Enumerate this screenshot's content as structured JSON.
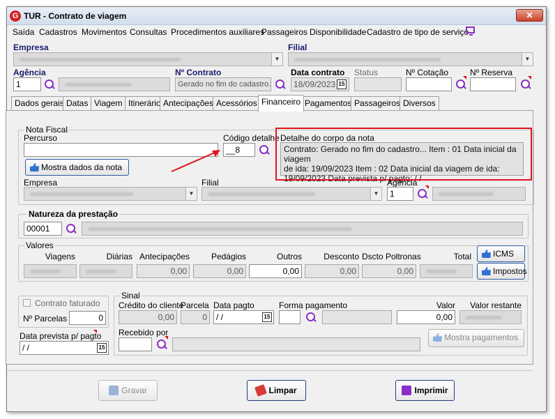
{
  "window": {
    "title": "TUR - Contrato de viagem",
    "close_label": "✕"
  },
  "menu": [
    "Saída",
    "Cadastros",
    "Movimentos",
    "Consultas",
    "Procedimentos auxiliares",
    "Passageiros",
    "Disponibilidade",
    "Cadastro de tipo de serviço"
  ],
  "header": {
    "empresa_label": "Empresa",
    "filial_label": "Filial",
    "agencia_label": "Agência",
    "agencia_value": "1",
    "contrato_label": "Nº Contrato",
    "contrato_value": "Gerado no fim do cadastro...",
    "data_contrato_label": "Data contrato",
    "data_contrato_value": "18/09/2023",
    "status_label": "Status",
    "cotacao_label": "Nº Cotação",
    "reserva_label": "Nº Reserva"
  },
  "tabs": [
    "Dados gerais",
    "Datas",
    "Viagem",
    "Itinerário",
    "Antecipações",
    "Acessórios",
    "Financeiro",
    "Pagamentos",
    "Passageiros",
    "Diversos"
  ],
  "active_tab": "Financeiro",
  "nota_fiscal": {
    "group_title": "Nota Fiscal",
    "percurso_label": "Percurso",
    "percurso_value": "",
    "codigo_detalhe_label": "Código detalhe",
    "codigo_detalhe_value": "__8",
    "mostra_button": "Mostra dados da nota",
    "empresa_label": "Empresa",
    "filial_label": "Filial",
    "agencia_label": "Agência",
    "agencia_value": "1",
    "detalhe_label": "Detalhe do corpo da nota",
    "detalhe_lines": [
      "Contrato: Gerado no fim do cadastro...  Item : 01  Data inicial da viagem",
      "de ida: 19/09/2023    Item : 02  Data inicial da viagem de ida:",
      "19/09/2023  Data prevista p/ pagto:  / /"
    ]
  },
  "natureza": {
    "title": "Natureza da prestação",
    "code": "00001"
  },
  "valores": {
    "title": "Valores",
    "headers": [
      "Viagens",
      "Diárias",
      "Antecipações",
      "Pedágios",
      "Outros",
      "Desconto",
      "Dscto Poltronas",
      "Total"
    ],
    "values": [
      "",
      "",
      "0,00",
      "0,00",
      "0,00",
      "0,00",
      "0,00",
      ""
    ],
    "icms_button": "ICMS",
    "impostos_button": "Impostos"
  },
  "faturado": {
    "contrato_faturado_label": "Contrato faturado",
    "parcelas_label": "Nº Parcelas",
    "parcelas_value": "0",
    "data_prevista_label": "Data prevista p/ pagto",
    "data_prevista_value": " / /"
  },
  "sinal": {
    "title": "Sinal",
    "credito_label": "Crédito do cliente",
    "credito_value": "0,00",
    "parcela_label": "Parcela",
    "parcela_value": "0",
    "data_pagto_label": "Data pagto",
    "data_pagto_value": " / /",
    "forma_label": "Forma pagamento",
    "valor_label": "Valor",
    "valor_value": "0,00",
    "valor_restante_label": "Valor restante",
    "recebido_label": "Recebido por",
    "mostra_pagamentos": "Mostra pagamentos"
  },
  "buttons": {
    "gravar": "Gravar",
    "limpar": "Limpar",
    "imprimir": "Imprimir"
  },
  "colors": {
    "accent": "#8a2fc4",
    "highlight": "#e0141c",
    "arrow": "#e0141c",
    "navy": "#1b1b6e"
  }
}
